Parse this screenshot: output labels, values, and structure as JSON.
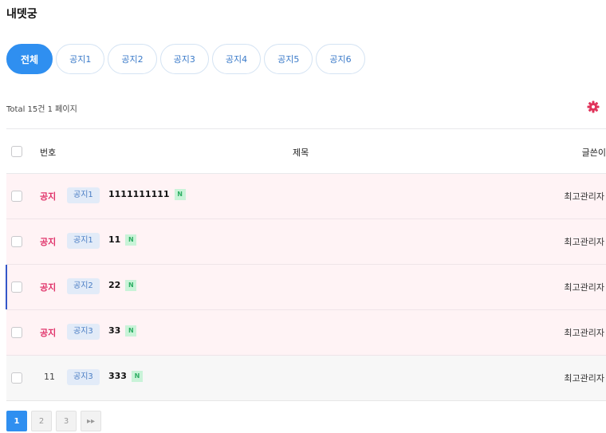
{
  "page": {
    "title": "내뎃궁"
  },
  "tabs": [
    "전체",
    "공지1",
    "공지2",
    "공지3",
    "공지4",
    "공지5",
    "공지6"
  ],
  "summary": "Total 15건 1 페이지",
  "settings_icon": "gear-icon",
  "colors": {
    "accent": "#2f8ff0",
    "notice": "#e0336a",
    "gear": "#e0335a"
  },
  "table": {
    "headers": {
      "num": "번호",
      "subject": "제목",
      "writer": "글쓴이"
    },
    "rows": [
      {
        "num": "공지",
        "category": "공지1",
        "subject": "1111111111",
        "badge": "N",
        "writer": "최고관리자"
      },
      {
        "num": "공지",
        "category": "공지1",
        "subject": "11",
        "badge": "N",
        "writer": "최고관리자"
      },
      {
        "num": "공지",
        "category": "공지2",
        "subject": "22",
        "badge": "N",
        "writer": "최고관리자"
      },
      {
        "num": "공지",
        "category": "공지3",
        "subject": "33",
        "badge": "N",
        "writer": "최고관리자"
      },
      {
        "num": "11",
        "category": "공지3",
        "subject": "333",
        "badge": "N",
        "writer": "최고관리자"
      }
    ]
  },
  "pagination": {
    "pages": [
      "1",
      "2",
      "3"
    ],
    "next_label": "▸▸"
  }
}
